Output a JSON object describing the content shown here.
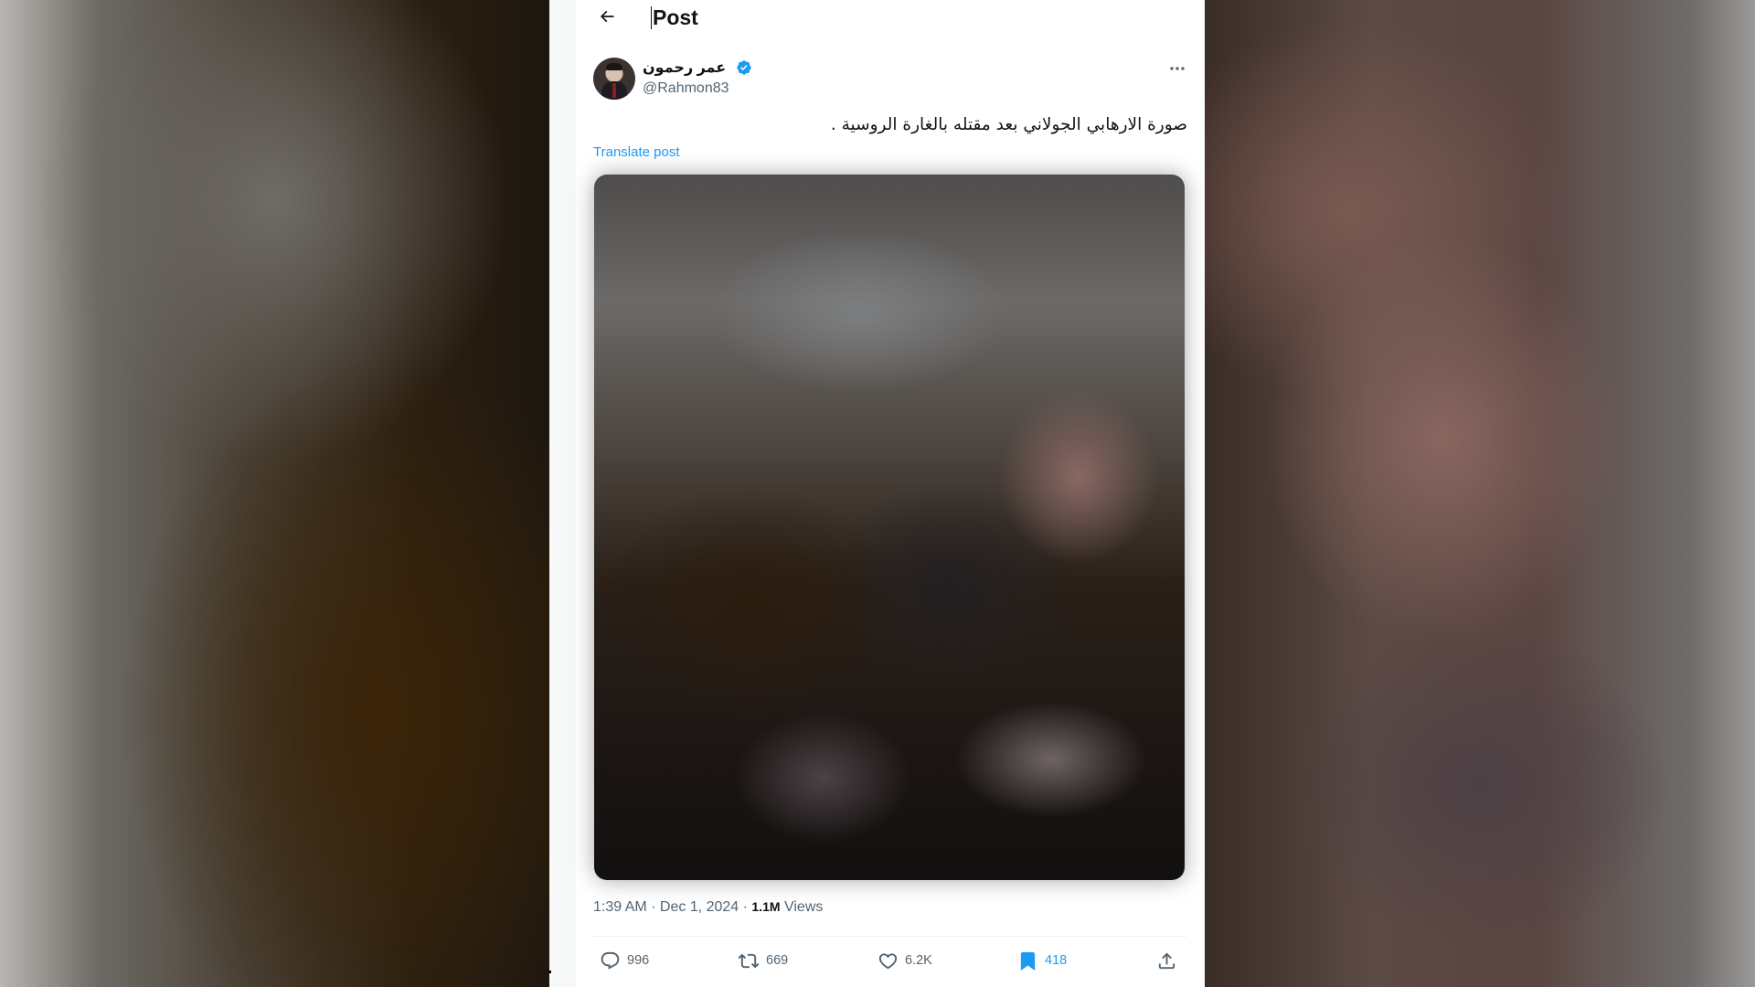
{
  "header": {
    "title": "Post",
    "back_icon": "arrow-left-icon"
  },
  "author": {
    "display_name": "عمر رحمون",
    "handle": "@Rahmon83",
    "verified": true,
    "verified_color": "#1d9bf0"
  },
  "post": {
    "text": "صورة الارهابي الجولاني بعد مقتله بالغارة الروسية .",
    "translate_label": "Translate post",
    "media_icon": "blurred-photo"
  },
  "meta": {
    "time_date": "1:39 AM · Dec 1, 2024 · ",
    "views_count": "1.1M",
    "views_label": " Views"
  },
  "actions": {
    "replies": "996",
    "reposts": "669",
    "likes": "6.2K",
    "bookmarks": "418"
  },
  "colors": {
    "accent": "#1d9bf0",
    "text_primary": "#0f1419",
    "text_secondary": "#536471"
  }
}
